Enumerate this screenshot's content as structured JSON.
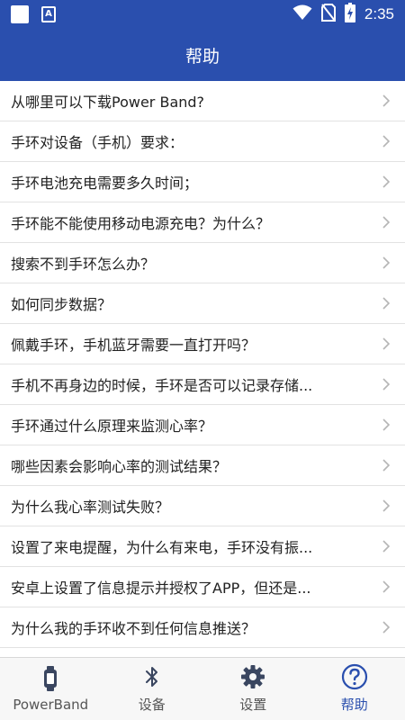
{
  "status_bar": {
    "time": "2:35",
    "notification_icons": [
      "square-notification-icon",
      "a-notification-icon"
    ],
    "system_icons": [
      "wifi-icon",
      "no-sim-icon",
      "battery-charging-icon"
    ]
  },
  "header": {
    "title": "帮助"
  },
  "faq": {
    "items": [
      {
        "label": "从哪里可以下载Power Band?"
      },
      {
        "label": "手环对设备（手机）要求："
      },
      {
        "label": "手环电池充电需要多久时间；"
      },
      {
        "label": "手环能不能使用移动电源充电？为什么？"
      },
      {
        "label": "搜索不到手环怎么办？"
      },
      {
        "label": "如何同步数据？"
      },
      {
        "label": "佩戴手环，手机蓝牙需要一直打开吗？"
      },
      {
        "label": "手机不再身边的时候，手环是否可以记录存储..."
      },
      {
        "label": "手环通过什么原理来监测心率？"
      },
      {
        "label": "哪些因素会影响心率的测试结果？"
      },
      {
        "label": "为什么我心率测试失败？"
      },
      {
        "label": "设置了来电提醒，为什么有来电，手环没有振..."
      },
      {
        "label": "安卓上设置了信息提示并授权了APP，但还是..."
      },
      {
        "label": "为什么我的手环收不到任何信息推送？"
      }
    ]
  },
  "bottom_nav": {
    "items": [
      {
        "label": "PowerBand",
        "icon": "band-icon"
      },
      {
        "label": "设备",
        "icon": "bluetooth-icon"
      },
      {
        "label": "设置",
        "icon": "gear-icon"
      },
      {
        "label": "帮助",
        "icon": "help-icon"
      }
    ],
    "active_index": 3
  },
  "colors": {
    "primary": "#2a4fae",
    "divider": "#e2e2e2",
    "nav_background": "#f7f7f7"
  }
}
